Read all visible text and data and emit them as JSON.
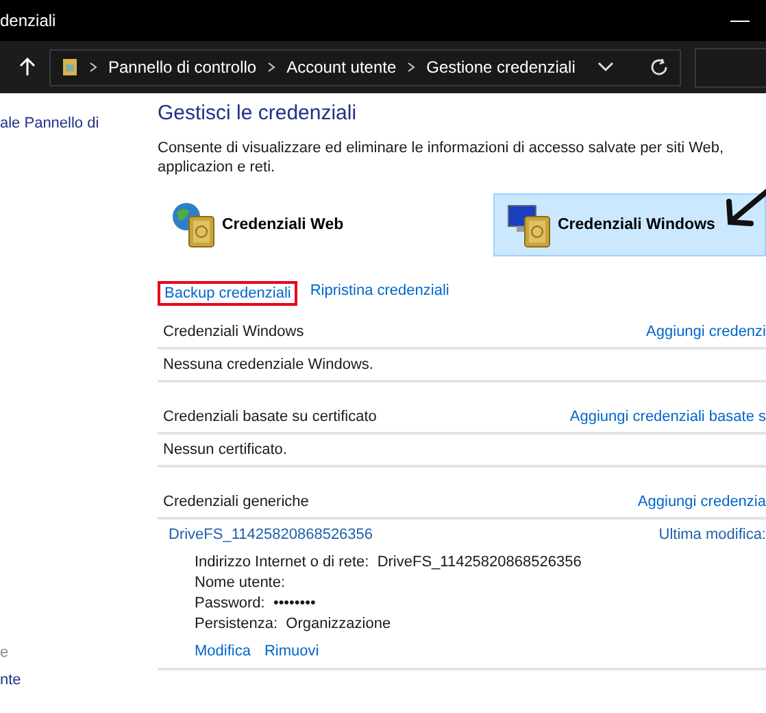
{
  "window": {
    "title": "denziali"
  },
  "address_bar": {
    "crumbs": [
      "Pannello di controllo",
      "Account utente",
      "Gestione credenziali"
    ]
  },
  "sidebar": {
    "items": [
      {
        "label": "ale Pannello di",
        "kind": "link"
      },
      {
        "label": "e",
        "kind": "heading"
      },
      {
        "label": "nte",
        "kind": "link"
      }
    ]
  },
  "main": {
    "title": "Gestisci le credenziali",
    "description": "Consente di visualizzare ed eliminare le informazioni di accesso salvate per siti Web, applicazion e reti.",
    "tabs": [
      {
        "label": "Credenziali Web",
        "kind": "web",
        "selected": false
      },
      {
        "label": "Credenziali Windows",
        "kind": "windows",
        "selected": true
      }
    ],
    "links": [
      {
        "label": "Backup credenziali",
        "highlighted": true
      },
      {
        "label": "Ripristina credenziali",
        "highlighted": false
      }
    ],
    "sections": [
      {
        "title": "Credenziali Windows",
        "action": "Aggiungi credenzi",
        "empty": "Nessuna credenziale Windows."
      },
      {
        "title": "Credenziali basate su certificato",
        "action": "Aggiungi credenziali basate s",
        "empty": "Nessun certificato."
      },
      {
        "title": "Credenziali generiche",
        "action": "Aggiungi credenzia",
        "items": [
          {
            "name": "DriveFS_11425820868526356",
            "modified": "Ultima modifica:",
            "details": [
              {
                "label": "Indirizzo Internet o di rete:",
                "value": "DriveFS_11425820868526356"
              },
              {
                "label": "Nome utente:"
              },
              {
                "label": "Password:",
                "value": "••••••••"
              },
              {
                "label": "Persistenza:",
                "value": "Organizzazione"
              }
            ],
            "actions": [
              "Modifica",
              "Rimuovi"
            ]
          }
        ]
      }
    ]
  }
}
